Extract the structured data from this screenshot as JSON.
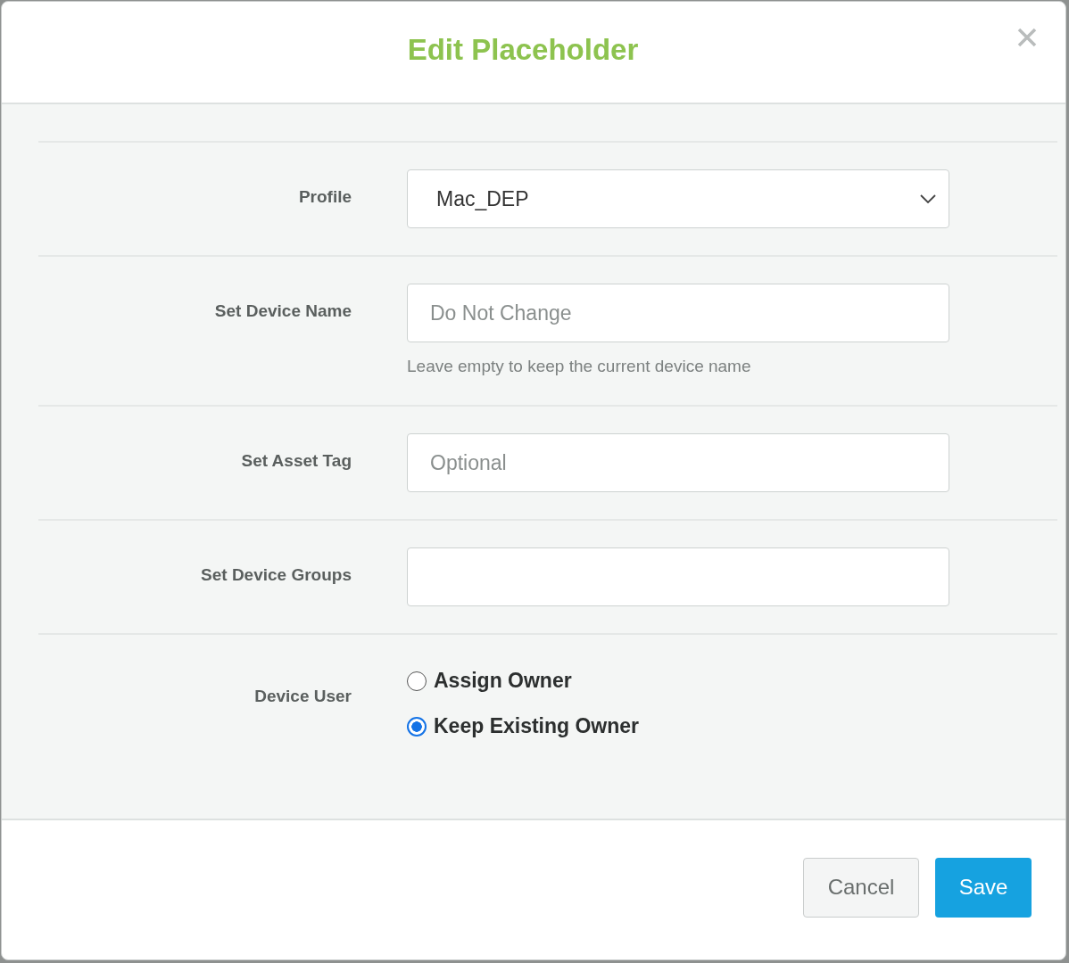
{
  "dialog": {
    "title": "Edit Placeholder"
  },
  "fields": [
    {
      "kind": "select",
      "label": "Profile",
      "value": "Mac_DEP"
    },
    {
      "kind": "text",
      "label": "Set Device Name",
      "placeholder": "Do Not Change",
      "help": "Leave empty to keep the current device name"
    },
    {
      "kind": "text",
      "label": "Set Asset Tag",
      "placeholder": "Optional"
    },
    {
      "kind": "text",
      "label": "Set Device Groups"
    },
    {
      "kind": "radio",
      "label": "Device User",
      "options": [
        {
          "label": "Assign Owner",
          "selected": false
        },
        {
          "label": "Keep Existing Owner",
          "selected": true
        }
      ]
    }
  ],
  "buttons": [
    {
      "kind": "secondary",
      "label": "Cancel"
    },
    {
      "kind": "primary",
      "label": "Save"
    }
  ]
}
